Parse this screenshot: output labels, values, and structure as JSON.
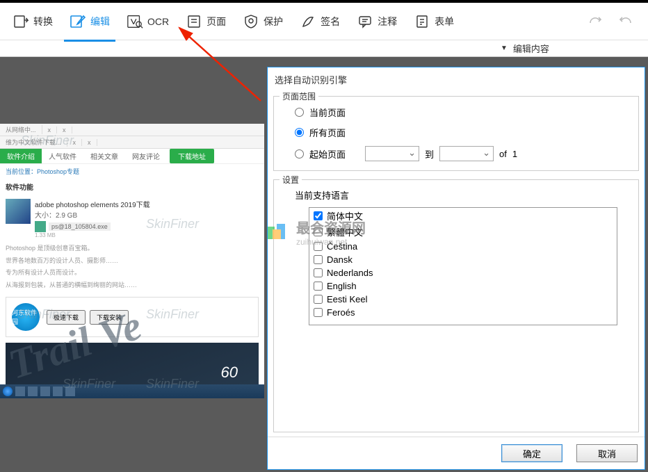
{
  "toolbar": {
    "convert": "转换",
    "edit": "编辑",
    "ocr": "OCR",
    "page": "页面",
    "protect": "保护",
    "sign": "签名",
    "annotate": "注释",
    "form": "表单"
  },
  "sub_bar": {
    "edit_content": "编辑内容"
  },
  "dialog": {
    "title": "选择自动识别引擎",
    "range_legend": "页面范围",
    "radio_current": "当前页面",
    "radio_all": "所有页面",
    "radio_start": "起始页面",
    "to": "到",
    "of": "of",
    "total_pages": "1",
    "settings_legend": "设置",
    "lang_label": "当前支持语言",
    "languages": [
      {
        "label": "简体中文",
        "checked": true
      },
      {
        "label": "繁體中文",
        "checked": false
      },
      {
        "label": "Čeština",
        "checked": false
      },
      {
        "label": "Dansk",
        "checked": false
      },
      {
        "label": "Nederlands",
        "checked": false
      },
      {
        "label": "English",
        "checked": false
      },
      {
        "label": "Eesti Keel",
        "checked": false
      },
      {
        "label": "Feroés",
        "checked": false
      }
    ],
    "ok": "确定",
    "cancel": "取消"
  },
  "preview": {
    "tabs": {
      "intro": "软件介绍",
      "hot": "人气软件",
      "related": "相关文章",
      "comment": "网友评论",
      "download": "下载地址"
    },
    "breadcrumb": "当前位置：Photoshop专题",
    "section": "软件功能",
    "item_name": "adobe photoshop elements 2019下载",
    "item_meta": "大小：2.9 GB",
    "exe_name": "ps@18_105804.exe",
    "exe_size": "1.33 MB",
    "p1": "Photoshop 是顶级创意百宝箱。",
    "p2": "世界各地数百万的设计人员、摄影师……",
    "p3": "专为所有设计人员而设计。",
    "p4": "从海报到包装，从普通的横幅到绚丽的网站……",
    "logo_text": "河东软件园",
    "btn1": "极速下载",
    "btn2": "下载安装",
    "sixty": "60"
  },
  "watermarks": {
    "trail": "Trail Ve",
    "sf": "SkinFiner",
    "brand": "最会资源网",
    "brand_sub": "zuihuiwan.net"
  }
}
